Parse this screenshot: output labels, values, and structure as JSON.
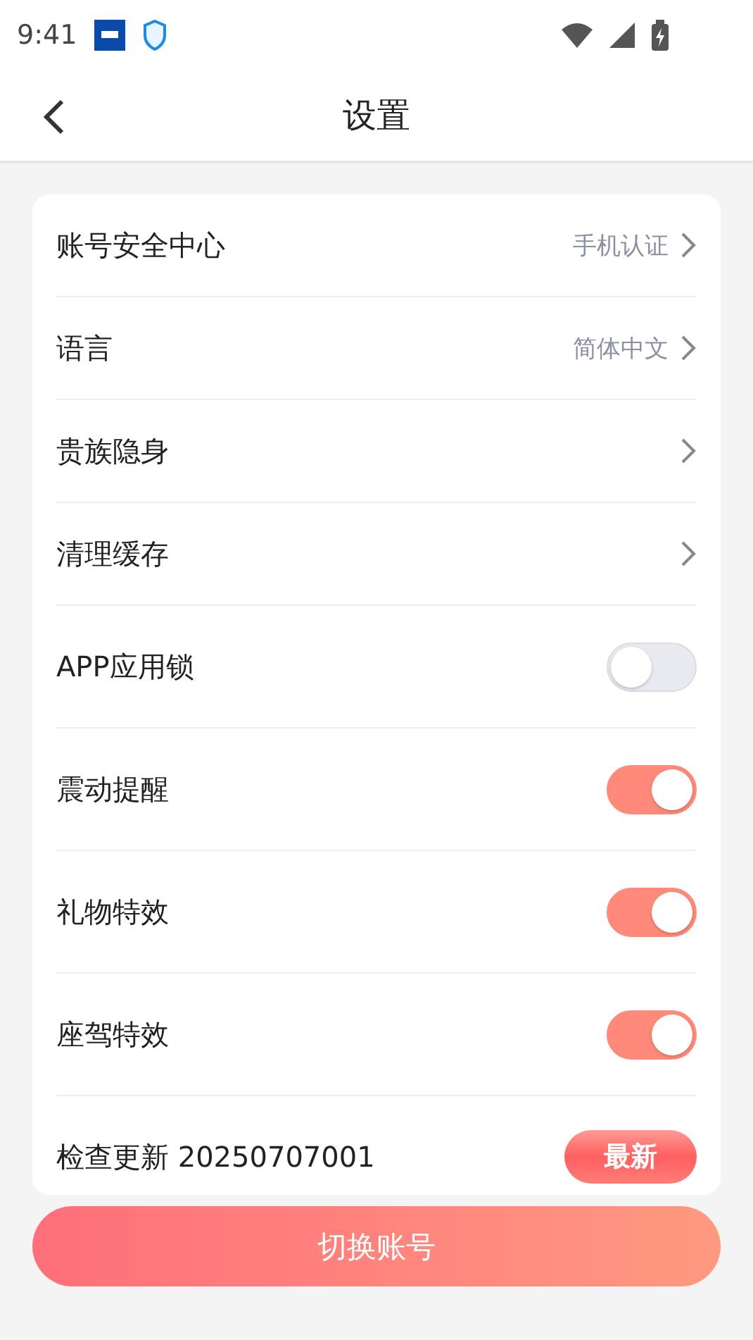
{
  "status_bar": {
    "time": "9:41"
  },
  "header": {
    "title": "设置"
  },
  "settings": [
    {
      "kind": "link",
      "label": "账号安全中心",
      "value": "手机认证"
    },
    {
      "kind": "link",
      "label": "语言",
      "value": "简体中文"
    },
    {
      "kind": "link",
      "label": "贵族隐身"
    },
    {
      "kind": "link",
      "label": "清理缓存"
    },
    {
      "kind": "toggle",
      "label": "APP应用锁",
      "on": false
    },
    {
      "kind": "toggle",
      "label": "震动提醒",
      "on": true
    },
    {
      "kind": "toggle",
      "label": "礼物特效",
      "on": true
    },
    {
      "kind": "toggle",
      "label": "座驾特效",
      "on": true
    },
    {
      "kind": "update",
      "label": "检查更新 20250707001",
      "badge": "最新"
    }
  ],
  "switch_account_button": "切换账号"
}
